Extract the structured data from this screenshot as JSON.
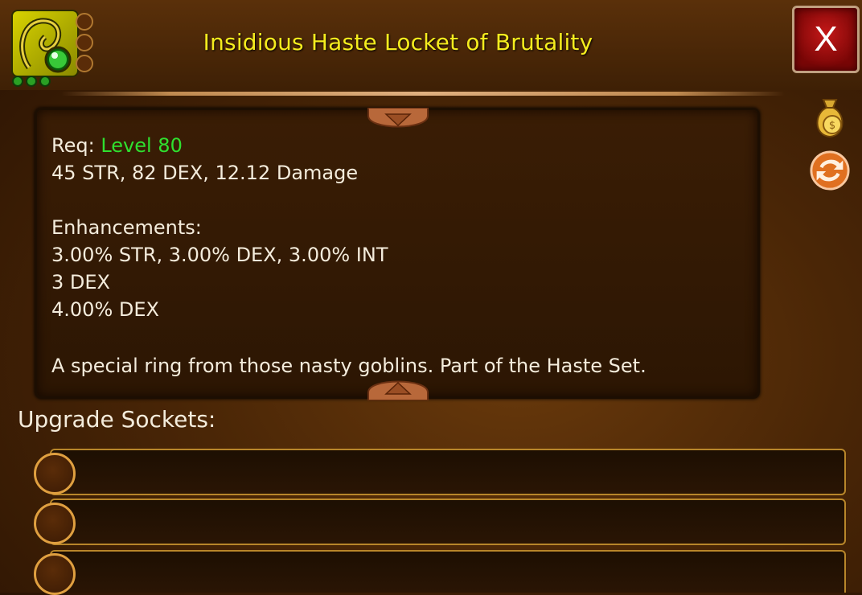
{
  "item": {
    "title": "Insidious Haste Locket of Brutality",
    "icon": "locket-item-icon",
    "pips": 3,
    "slots": 3
  },
  "close_button": {
    "label": "X"
  },
  "side_buttons": [
    {
      "name": "sell-gold-bag-button",
      "icon": "gold-bag-icon"
    },
    {
      "name": "swap-button",
      "icon": "swap-arrows-icon"
    }
  ],
  "description": {
    "req_label": "Req: ",
    "req_level": "Level 80",
    "stats_line": "45 STR, 82 DEX, 12.12 Damage",
    "enhancements_label": "Enhancements:",
    "enhancements": [
      "3.00% STR, 3.00% DEX, 3.00% INT",
      "3 DEX",
      "4.00% DEX"
    ],
    "flavor": "A special ring from those nasty goblins. Part of the Haste Set."
  },
  "upgrade_sockets": {
    "label": "Upgrade Sockets:",
    "count": 3
  },
  "colors": {
    "title": "#f5ec1e",
    "level": "#2fe02f",
    "close": "#c41818",
    "socket_border": "#e0a040"
  }
}
